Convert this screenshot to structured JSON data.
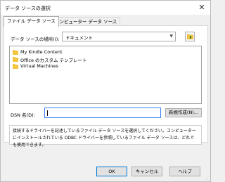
{
  "window": {
    "title": "データ ソースの選択",
    "close_symbol": "✕"
  },
  "tabs": [
    {
      "label": "ファイル データ ソース",
      "active": true
    },
    {
      "label": "コンピューター データ ソース",
      "active": false
    }
  ],
  "lookin": {
    "label": "データ ソースの場所(I):",
    "value": "ドキュメント",
    "icon": "documents-folder-icon"
  },
  "up_folder_button": {
    "icon": "up-folder-icon"
  },
  "file_list": {
    "items": [
      {
        "name": "My Kindle Content",
        "icon": "folder-icon"
      },
      {
        "name": "Office のカスタム テンプレート",
        "icon": "folder-icon"
      },
      {
        "name": "Virtual Machines",
        "icon": "folder-icon"
      }
    ]
  },
  "dsn": {
    "label": "DSN 名(D):",
    "value": "",
    "new_button": "新規作成(N)..."
  },
  "description": "接続するドライバーを記述しているファイル データ ソースを選択してください。コンピューターにインストールされている ODBC ドライバーを参照しているファイル データ ソースは、どれでも使用できます。",
  "buttons": {
    "ok": "OK",
    "cancel": "キャンセル",
    "help": "ヘルプ"
  },
  "colors": {
    "folder": "#f4c542",
    "focus": "#3b82f6",
    "ok_border": "#0078d7"
  }
}
